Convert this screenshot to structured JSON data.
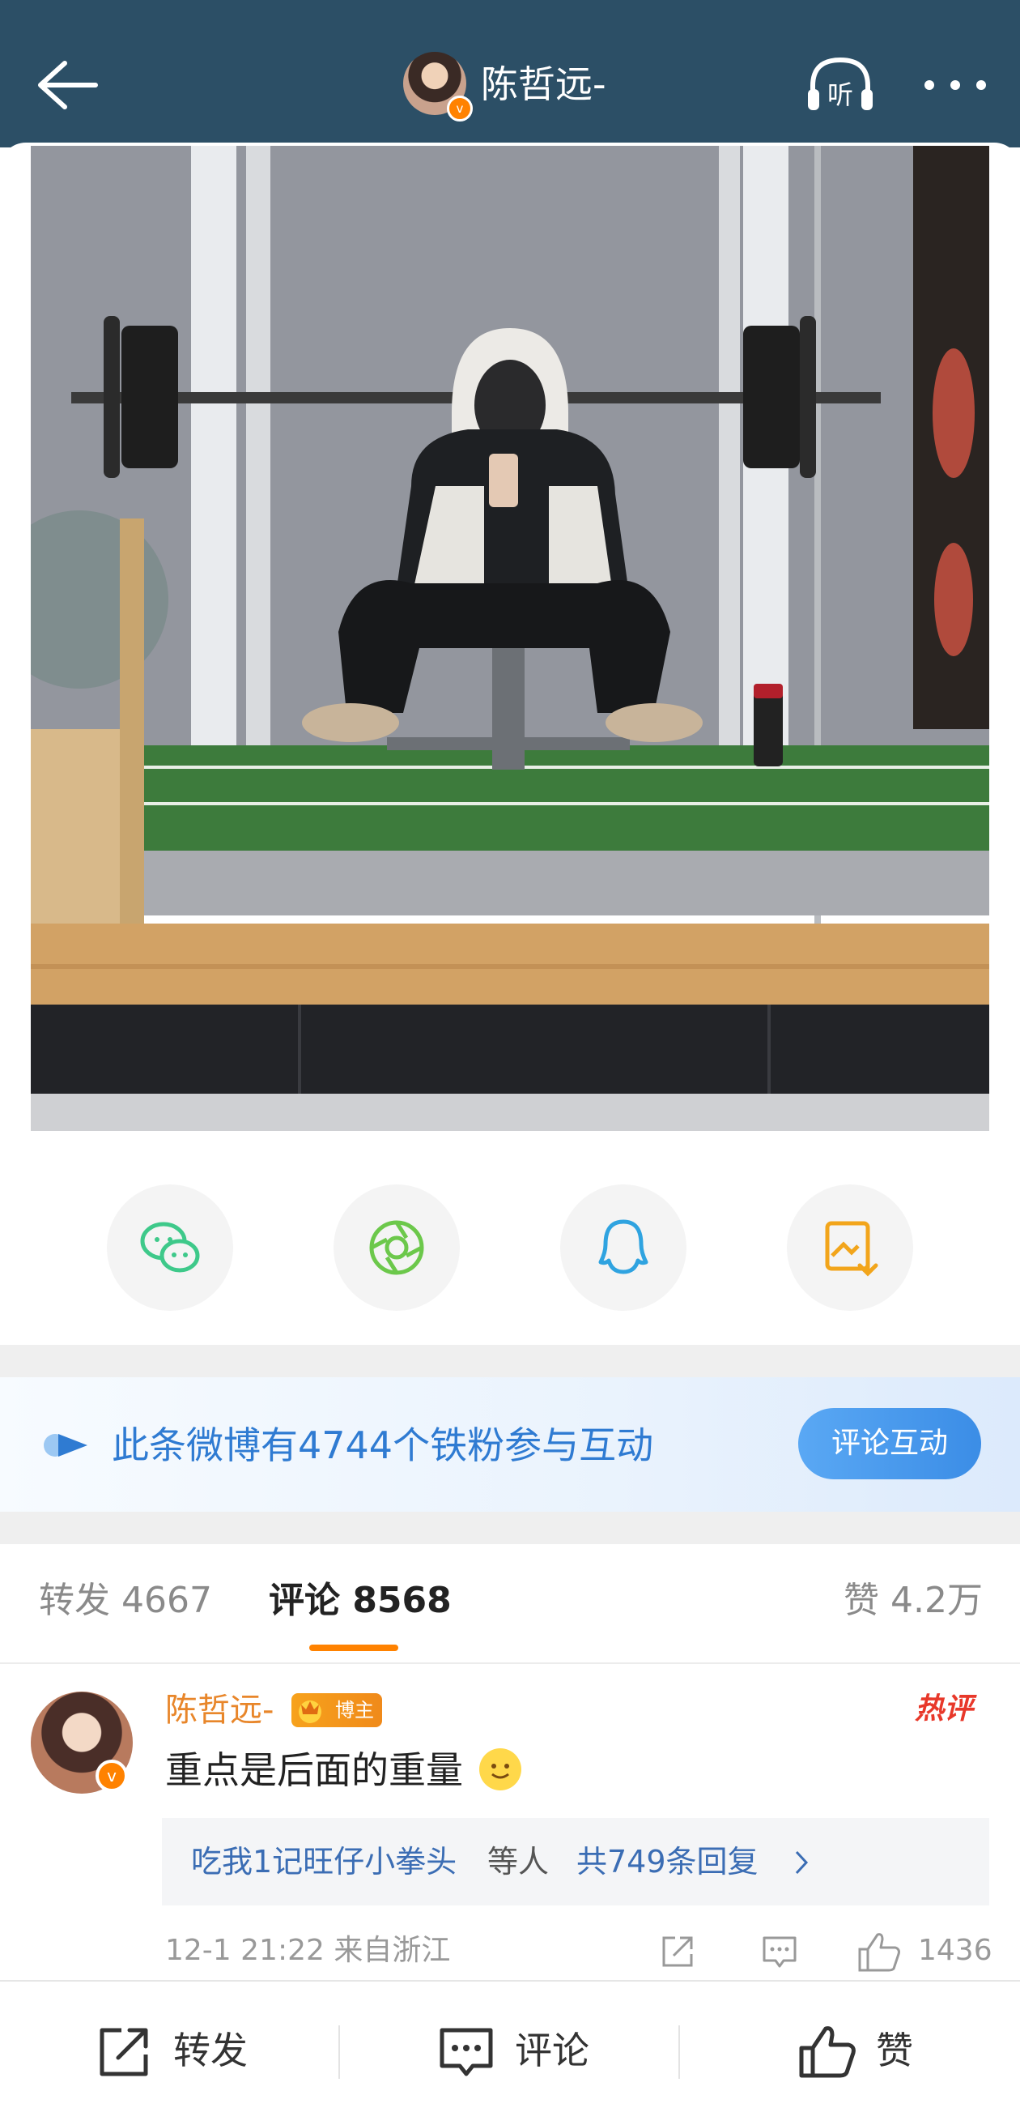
{
  "header": {
    "title": "陈哲远-",
    "avatar_badge": "v",
    "listen_label": "听",
    "back_icon": "arrow-left-icon",
    "listen_icon": "headphones-icon",
    "more_icon": "more-dots-icon"
  },
  "share": {
    "items": [
      {
        "icon": "wechat-icon",
        "color": "#3ec98a"
      },
      {
        "icon": "moments-icon",
        "color": "#6cc84b"
      },
      {
        "icon": "qq-icon",
        "color": "#2fa3e0"
      },
      {
        "icon": "save-image-icon",
        "color": "#f2a51b"
      }
    ]
  },
  "fans": {
    "text": "此条微博有4744个铁粉参与互动",
    "cta": "评论互动"
  },
  "tabs": {
    "repost": "转发 4667",
    "comment": "评论 8568",
    "like": "赞 4.2万"
  },
  "comment": {
    "author": "陈哲远-",
    "author_badge": "博主",
    "avatar_badge": "v",
    "hot_label": "热评",
    "text": "重点是后面的重量",
    "replies_user": "吃我1记旺仔小拳头",
    "replies_mid": "等人",
    "replies_count": "共749条回复",
    "time_location": "12-1 21:22  来自浙江",
    "like_count": "1436"
  },
  "bottom_bar": {
    "repost": "转发",
    "comment": "评论",
    "like": "赞"
  },
  "colors": {
    "header_bg": "#2c4f66",
    "accent_orange": "#ff8200",
    "link_blue": "#3b6db4"
  }
}
